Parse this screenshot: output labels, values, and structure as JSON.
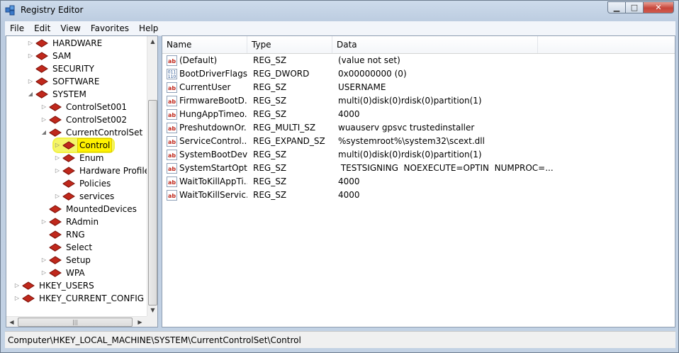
{
  "window": {
    "title": "Registry Editor"
  },
  "menu": [
    "File",
    "Edit",
    "View",
    "Favorites",
    "Help"
  ],
  "tree": {
    "nodes": [
      {
        "label": "HARDWARE",
        "expander": "▷"
      },
      {
        "label": "SAM",
        "expander": "▷"
      },
      {
        "label": "SECURITY",
        "expander": ""
      },
      {
        "label": "SOFTWARE",
        "expander": "▷"
      },
      {
        "label": "SYSTEM",
        "expander": "◢"
      },
      {
        "label": "ControlSet001",
        "expander": "▷"
      },
      {
        "label": "ControlSet002",
        "expander": "▷"
      },
      {
        "label": "CurrentControlSet",
        "expander": "◢"
      },
      {
        "label": "Control",
        "expander": "▷",
        "selected": true
      },
      {
        "label": "Enum",
        "expander": "▷"
      },
      {
        "label": "Hardware Profiles",
        "expander": "▷"
      },
      {
        "label": "Policies",
        "expander": ""
      },
      {
        "label": "services",
        "expander": "▷"
      },
      {
        "label": "MountedDevices",
        "expander": ""
      },
      {
        "label": "RAdmin",
        "expander": "▷"
      },
      {
        "label": "RNG",
        "expander": ""
      },
      {
        "label": "Select",
        "expander": ""
      },
      {
        "label": "Setup",
        "expander": "▷"
      },
      {
        "label": "WPA",
        "expander": "▷"
      },
      {
        "label": "HKEY_USERS",
        "expander": "▷"
      },
      {
        "label": "HKEY_CURRENT_CONFIG",
        "expander": "▷"
      }
    ]
  },
  "list": {
    "columns": [
      "Name",
      "Type",
      "Data"
    ],
    "rows": [
      {
        "icon": "string-value-icon",
        "name": "(Default)",
        "type": "REG_SZ",
        "data": "(value not set)"
      },
      {
        "icon": "binary-value-icon",
        "name": "BootDriverFlags",
        "type": "REG_DWORD",
        "data": "0x00000000 (0)"
      },
      {
        "icon": "string-value-icon",
        "name": "CurrentUser",
        "type": "REG_SZ",
        "data": "USERNAME"
      },
      {
        "icon": "string-value-icon",
        "name": "FirmwareBootD...",
        "type": "REG_SZ",
        "data": "multi(0)disk(0)rdisk(0)partition(1)"
      },
      {
        "icon": "string-value-icon",
        "name": "HungAppTimeo...",
        "type": "REG_SZ",
        "data": "4000"
      },
      {
        "icon": "string-value-icon",
        "name": "PreshutdownOr...",
        "type": "REG_MULTI_SZ",
        "data": "wuauserv gpsvc trustedinstaller"
      },
      {
        "icon": "string-value-icon",
        "name": "ServiceControl...",
        "type": "REG_EXPAND_SZ",
        "data": "%systemroot%\\system32\\scext.dll"
      },
      {
        "icon": "string-value-icon",
        "name": "SystemBootDevi...",
        "type": "REG_SZ",
        "data": "multi(0)disk(0)rdisk(0)partition(1)"
      },
      {
        "icon": "string-value-icon",
        "name": "SystemStartOpti...",
        "type": "REG_SZ",
        "data": " TESTSIGNING  NOEXECUTE=OPTIN  NUMPROC=..."
      },
      {
        "icon": "string-value-icon",
        "name": "WaitToKillAppTi...",
        "type": "REG_SZ",
        "data": "4000"
      },
      {
        "icon": "string-value-icon",
        "name": "WaitToKillServic...",
        "type": "REG_SZ",
        "data": "4000"
      }
    ]
  },
  "status": {
    "path": "Computer\\HKEY_LOCAL_MACHINE\\SYSTEM\\CurrentControlSet\\Control"
  },
  "colors": {
    "selection": "#fff200",
    "folder_red": "#c0281c",
    "window_frame": "#c7d5e6"
  }
}
